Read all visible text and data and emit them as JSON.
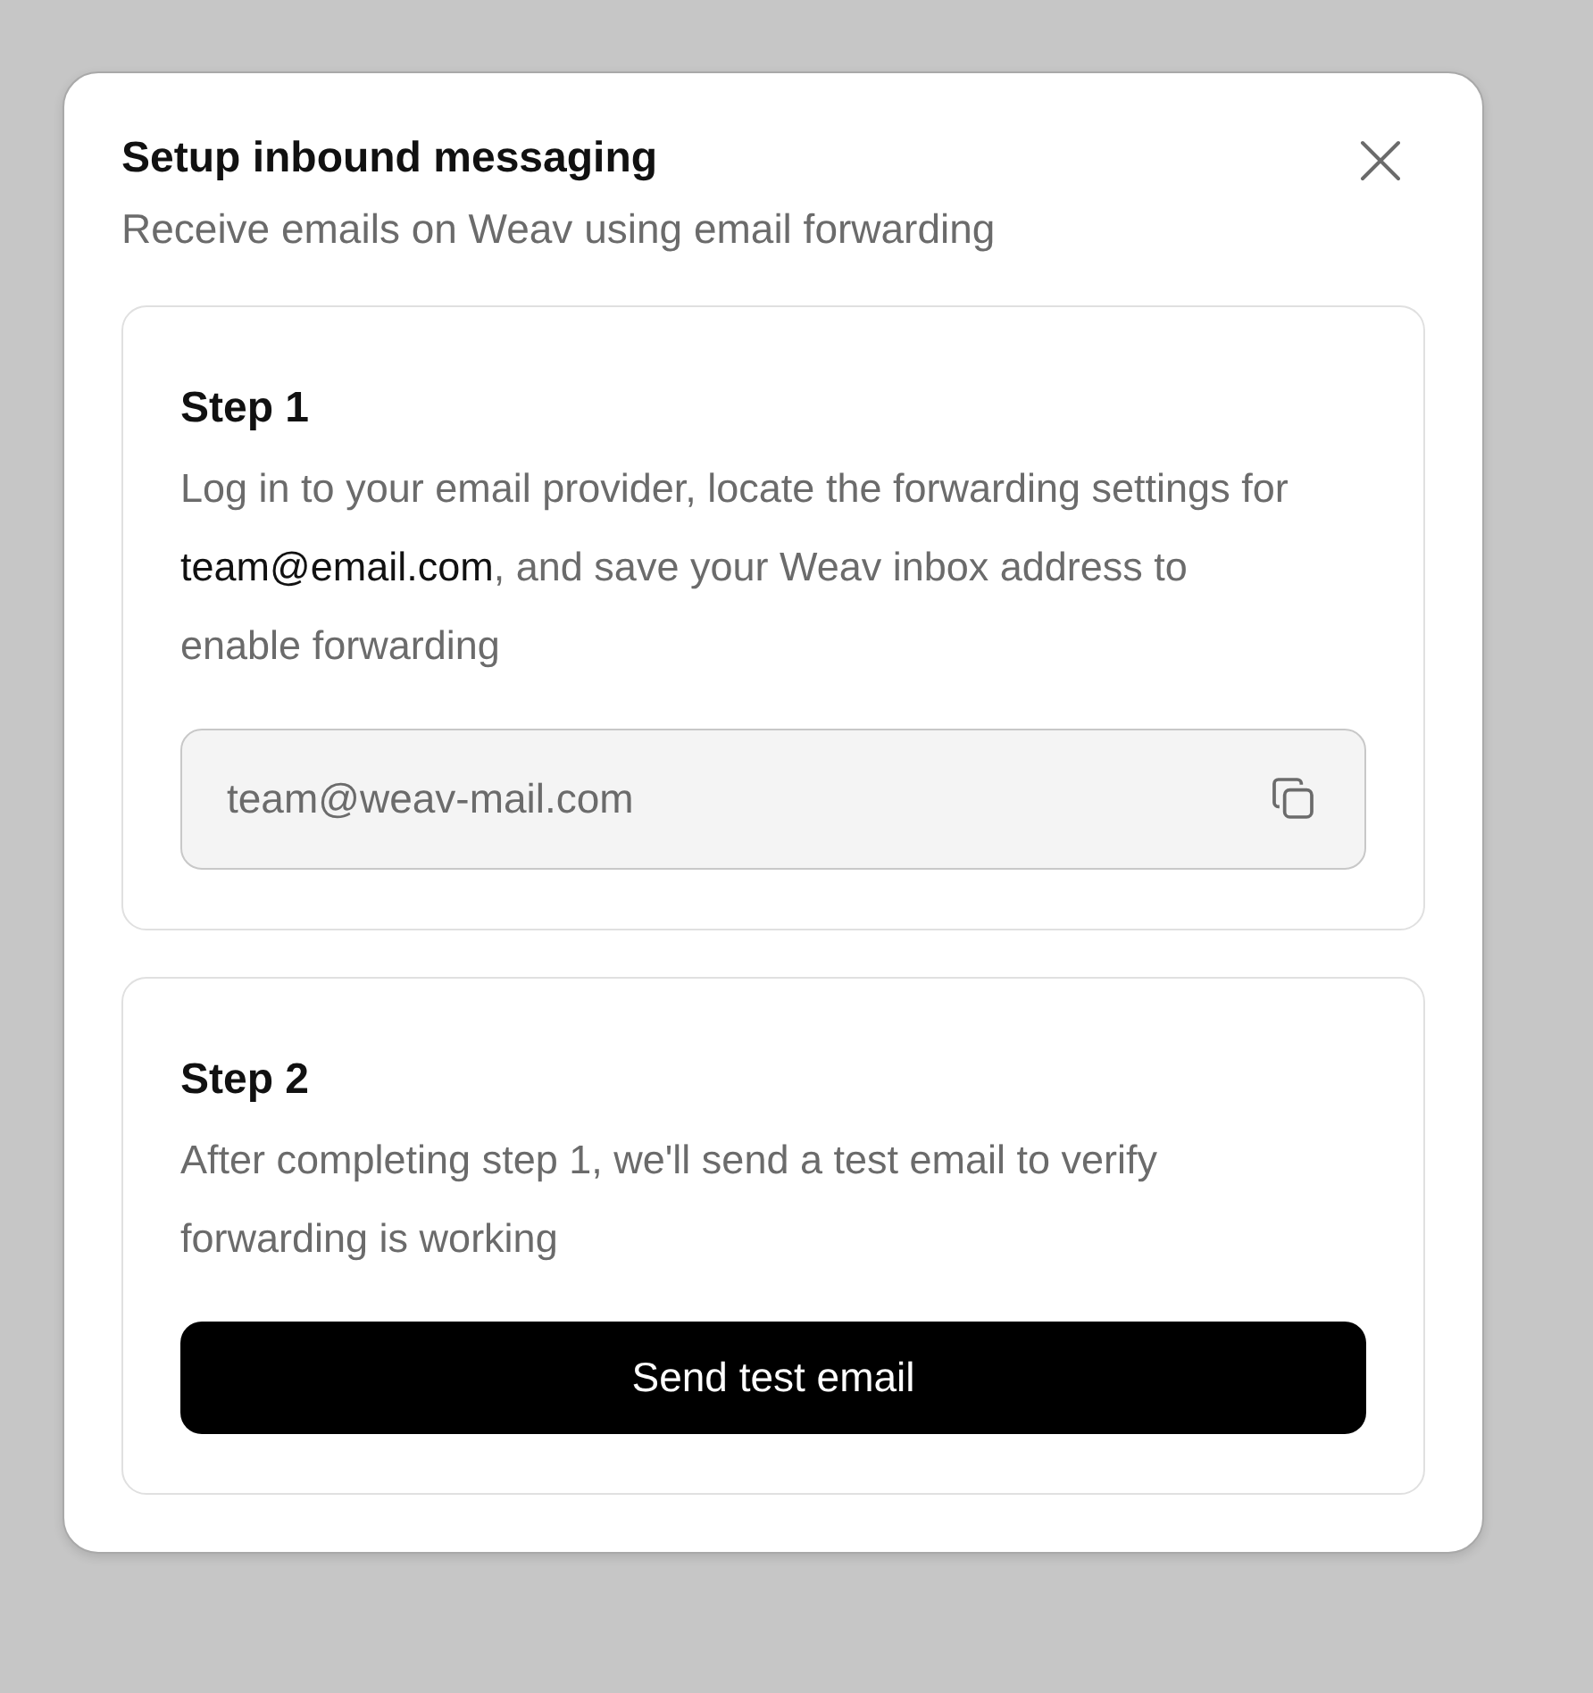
{
  "dialog": {
    "title": "Setup inbound messaging",
    "subtitle": "Receive emails on Weav using email forwarding"
  },
  "steps": [
    {
      "kind": "field",
      "title": "Step 1",
      "description": "Log in to your email provider, locate the forwarding settings for **team@email.com**, and save your Weav inbox address to enable forwarding",
      "value": "team@weav-mail.com"
    },
    {
      "kind": "button",
      "title": "Step 2",
      "description": "After completing step 1, we'll send a test email to verify forwarding is working",
      "label": "Send test email"
    }
  ]
}
